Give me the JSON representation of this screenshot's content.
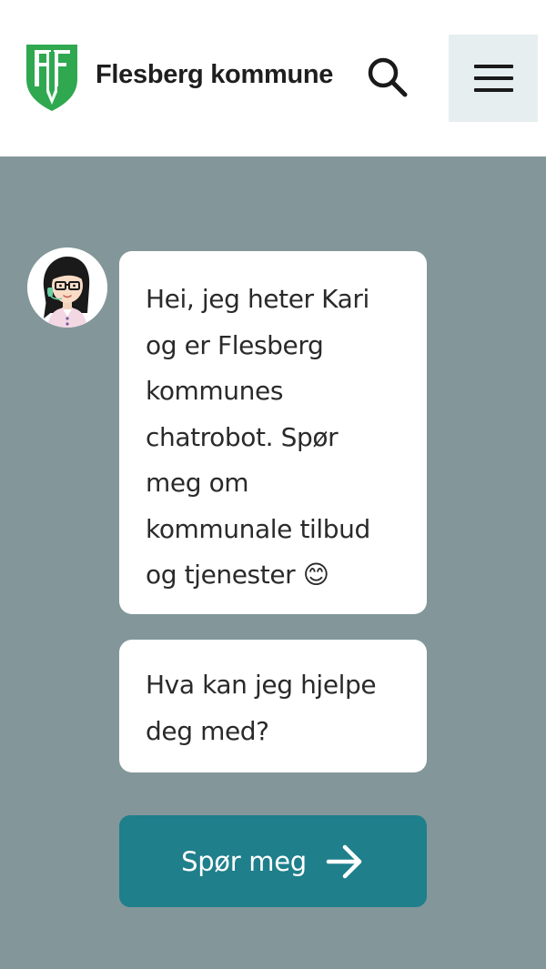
{
  "header": {
    "brand_name": "Flesberg kommune",
    "icons": {
      "logo": "flesberg-coat-of-arms",
      "search": "search-icon",
      "menu": "hamburger-menu-icon"
    }
  },
  "chat": {
    "avatar": "chatbot-avatar-kari",
    "messages": [
      "Hei, jeg heter Kari og er Flesberg kommunes chatrobot. Spør meg om kommunale tilbud og tjenester 😊",
      "Hva kan jeg hjelpe deg med?"
    ],
    "cta_label": "Spør meg",
    "cta_icon": "arrow-right-icon"
  },
  "colors": {
    "accent": "#1f7f8b",
    "background": "#83979a",
    "logo_green": "#2fa84f",
    "menu_bg": "#e6eef0"
  }
}
